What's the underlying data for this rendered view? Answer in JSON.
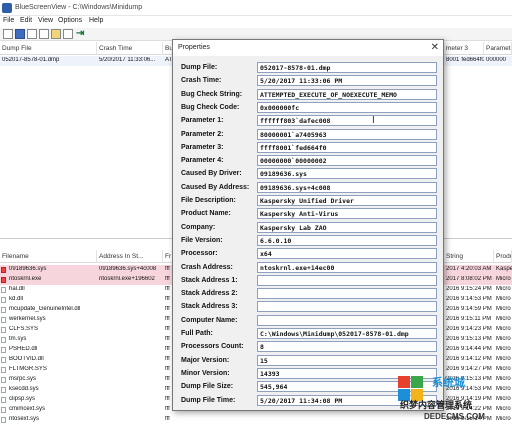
{
  "window": {
    "title": "BlueScreenView  -  C:\\Windows\\Minidump"
  },
  "menu": [
    "File",
    "Edit",
    "View",
    "Options",
    "Help"
  ],
  "toolbar": {
    "icons": [
      "open-icon",
      "save-icon",
      "copy-icon",
      "html-report-icon",
      "properties-icon",
      "refresh-icon",
      "exit-icon"
    ]
  },
  "top_list": {
    "columns": [
      "Dump File",
      "Crash Time",
      "Bu",
      "...",
      "...",
      "meter 3",
      "Parameter 4"
    ],
    "rows": [
      {
        "dump_file": "052017-8578-01.dmp",
        "crash_time": "5/20/2017 11:33:06...",
        "bug": "AT",
        "param3": "8001`fed664f0",
        "param4": "000000"
      }
    ]
  },
  "bottom_list": {
    "columns": [
      "Filename",
      "Address In St...",
      "Fr",
      "String",
      "Produ"
    ],
    "rows": [
      {
        "name": "09189636.sys",
        "addr": "09189636.sys+4c008",
        "from": "fff",
        "string": "2017 4:20:03 AM",
        "product": "Kaspe",
        "highlight": true
      },
      {
        "name": "ntoskrnl.exe",
        "addr": "ntoskrnl.exe+196602",
        "from": "fff",
        "string": "2017 8:08:02 PM",
        "product": "Micro",
        "highlight": true
      },
      {
        "name": "hal.dll",
        "addr": "",
        "from": "fff",
        "string": "2016 9:15:24 PM",
        "product": "Micro",
        "highlight": false
      },
      {
        "name": "kd.dll",
        "addr": "",
        "from": "fff",
        "string": "2016 9:14:53 PM",
        "product": "Micro",
        "highlight": false
      },
      {
        "name": "mcupdate_GenuineIntel.dll",
        "addr": "",
        "from": "fff",
        "string": "2016 9:14:59 PM",
        "product": "Micro",
        "highlight": false
      },
      {
        "name": "werkernel.sys",
        "addr": "",
        "from": "fff",
        "string": "2016 9:15:11 PM",
        "product": "Micro",
        "highlight": false
      },
      {
        "name": "CLFS.SYS",
        "addr": "",
        "from": "fff",
        "string": "2016 9:14:23 PM",
        "product": "Micro",
        "highlight": false
      },
      {
        "name": "tm.sys",
        "addr": "",
        "from": "fff",
        "string": "2016 9:15:13 PM",
        "product": "Micro",
        "highlight": false
      },
      {
        "name": "PSHED.dll",
        "addr": "",
        "from": "fff",
        "string": "2016 9:14:44 PM",
        "product": "Micro",
        "highlight": false
      },
      {
        "name": "BOOTVID.dll",
        "addr": "",
        "from": "fff",
        "string": "2016 9:14:12 PM",
        "product": "Micro",
        "highlight": false
      },
      {
        "name": "FLTMGR.SYS",
        "addr": "",
        "from": "fff",
        "string": "2016 9:14:27 PM",
        "product": "Micro",
        "highlight": false
      },
      {
        "name": "msrpc.sys",
        "addr": "",
        "from": "fff",
        "string": "2016 9:15:13 PM",
        "product": "Micro",
        "highlight": false
      },
      {
        "name": "ksecdd.sys",
        "addr": "",
        "from": "fff",
        "string": "2016 9:14:53 PM",
        "product": "Micro",
        "highlight": false
      },
      {
        "name": "clipsp.sys",
        "addr": "",
        "from": "fff",
        "string": "2016 9:14:19 PM",
        "product": "Micro",
        "highlight": false
      },
      {
        "name": "cmimcext.sys",
        "addr": "",
        "from": "fff",
        "string": "2016 9:14:22 PM",
        "product": "Micro",
        "highlight": false
      },
      {
        "name": "ntosext.sys",
        "addr": "",
        "from": "fff",
        "string": "2016 9:15:14 PM",
        "product": "Micro",
        "highlight": false
      }
    ]
  },
  "dialog": {
    "title": "Properties",
    "close": "✕",
    "fields": [
      {
        "label": "Dump File:",
        "value": "052017-8578-01.dmp"
      },
      {
        "label": "Crash Time:",
        "value": "5/20/2017 11:33:06 PM"
      },
      {
        "label": "Bug Check String:",
        "value": "ATTEMPTED_EXECUTE_OF_NOEXECUTE_MEMO"
      },
      {
        "label": "Bug Check Code:",
        "value": "0x000000fc"
      },
      {
        "label": "Parameter 1:",
        "value": "ffffff803`dafec008"
      },
      {
        "label": "Parameter 2:",
        "value": "80000001`a7405963"
      },
      {
        "label": "Parameter 3:",
        "value": "ffff8001`fed664f0"
      },
      {
        "label": "Parameter 4:",
        "value": "00000000`00000002"
      },
      {
        "label": "Caused By Driver:",
        "value": "09189636.sys"
      },
      {
        "label": "Caused By Address:",
        "value": "09189636.sys+4c008"
      },
      {
        "label": "File Description:",
        "value": "Kaspersky Unified Driver"
      },
      {
        "label": "Product Name:",
        "value": "Kaspersky Anti-Virus"
      },
      {
        "label": "Company:",
        "value": "Kaspersky Lab ZAO"
      },
      {
        "label": "File Version:",
        "value": "6.6.0.10"
      },
      {
        "label": "Processor:",
        "value": "x64"
      },
      {
        "label": "Crash Address:",
        "value": "ntoskrnl.exe+14ec00"
      },
      {
        "label": "Stack Address 1:",
        "value": ""
      },
      {
        "label": "Stack Address 2:",
        "value": ""
      },
      {
        "label": "Stack Address 3:",
        "value": ""
      },
      {
        "label": "Computer Name:",
        "value": ""
      },
      {
        "label": "Full Path:",
        "value": "C:\\Windows\\Minidump\\052017-8578-01.dmp"
      },
      {
        "label": "Processors Count:",
        "value": "8"
      },
      {
        "label": "Major Version:",
        "value": "15"
      },
      {
        "label": "Minor Version:",
        "value": "14393"
      },
      {
        "label": "Dump File Size:",
        "value": "545,964"
      },
      {
        "label": "Dump File Time:",
        "value": "5/20/2017 11:34:08 PM"
      }
    ]
  },
  "watermark": {
    "brand": "系统城",
    "subtitle": "织梦内容管理系统",
    "domain": "DEDECMS.COM",
    "colors": {
      "blue": "#1d8fd6",
      "red": "#e8402f",
      "green": "#3aa84a",
      "yellow": "#f2b31b"
    }
  }
}
